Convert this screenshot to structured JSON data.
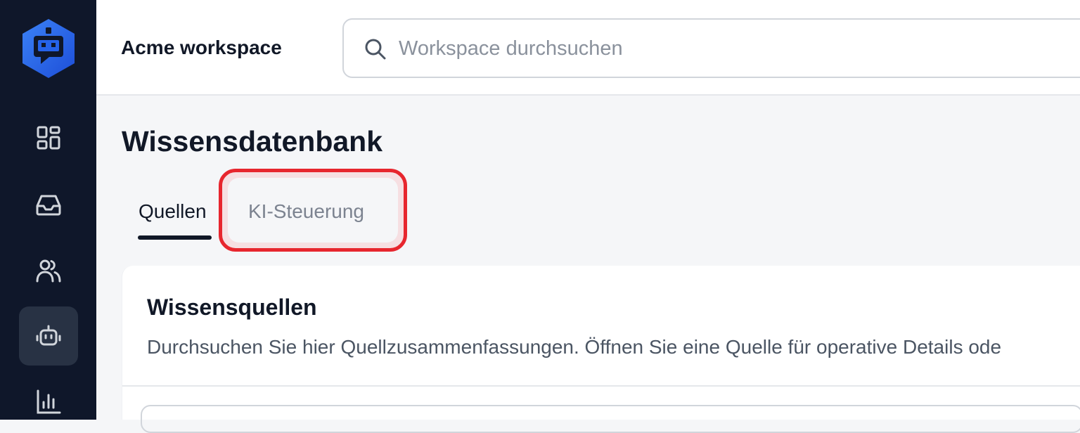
{
  "colors": {
    "sidebar_bg": "#0f172a",
    "brand_blue": "#2563eb",
    "highlight_red": "#e7262e",
    "text_primary": "#111827",
    "text_muted": "#7c8390"
  },
  "sidebar": {
    "logo_icon": "robot-chat-logo",
    "items": [
      {
        "icon": "dashboard-grid-icon",
        "active": false
      },
      {
        "icon": "inbox-tray-icon",
        "active": false
      },
      {
        "icon": "users-icon",
        "active": false
      },
      {
        "icon": "bot-icon",
        "active": true
      },
      {
        "icon": "bar-chart-icon",
        "active": false
      }
    ]
  },
  "header": {
    "workspace_name": "Acme workspace",
    "search_placeholder": "Workspace durchsuchen",
    "search_icon": "search-icon"
  },
  "main": {
    "title": "Wissensdatenbank",
    "tabs": [
      {
        "label": "Quellen",
        "active": true
      },
      {
        "label": "KI-Steuerung",
        "active": false,
        "highlighted": true
      }
    ],
    "card": {
      "title": "Wissensquellen",
      "description": "Durchsuchen Sie hier Quellzusammenfassungen. Öffnen Sie eine Quelle für operative Details ode"
    }
  }
}
